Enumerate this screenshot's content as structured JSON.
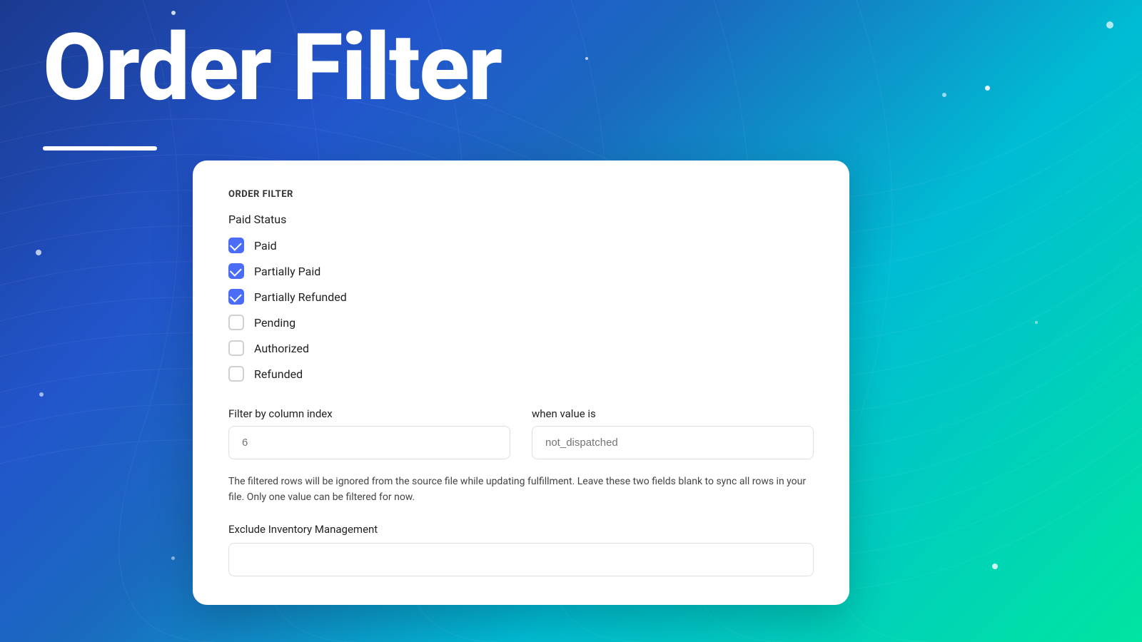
{
  "background": {
    "gradient_start": "#1a3a8f",
    "gradient_end": "#00e5a0"
  },
  "hero": {
    "title": "Order Filter",
    "underline": true
  },
  "card": {
    "section_label": "ORDER FILTER",
    "paid_status_label": "Paid Status",
    "checkboxes": [
      {
        "id": "paid",
        "label": "Paid",
        "checked": true
      },
      {
        "id": "partially_paid",
        "label": "Partially Paid",
        "checked": true
      },
      {
        "id": "partially_refunded",
        "label": "Partially Refunded",
        "checked": true
      },
      {
        "id": "pending",
        "label": "Pending",
        "checked": false
      },
      {
        "id": "authorized",
        "label": "Authorized",
        "checked": false
      },
      {
        "id": "refunded",
        "label": "Refunded",
        "checked": false
      }
    ],
    "filter_column": {
      "label": "Filter by column index",
      "placeholder": "6",
      "value": ""
    },
    "filter_value": {
      "label": "when value is",
      "placeholder": "not_dispatched",
      "value": ""
    },
    "helper_text": "The filtered rows will be ignored from the source file while updating fulfillment. Leave these two fields blank to sync all rows in your file. Only one value can be filtered for now.",
    "exclude_label": "Exclude Inventory Management",
    "exclude_placeholder": ""
  }
}
